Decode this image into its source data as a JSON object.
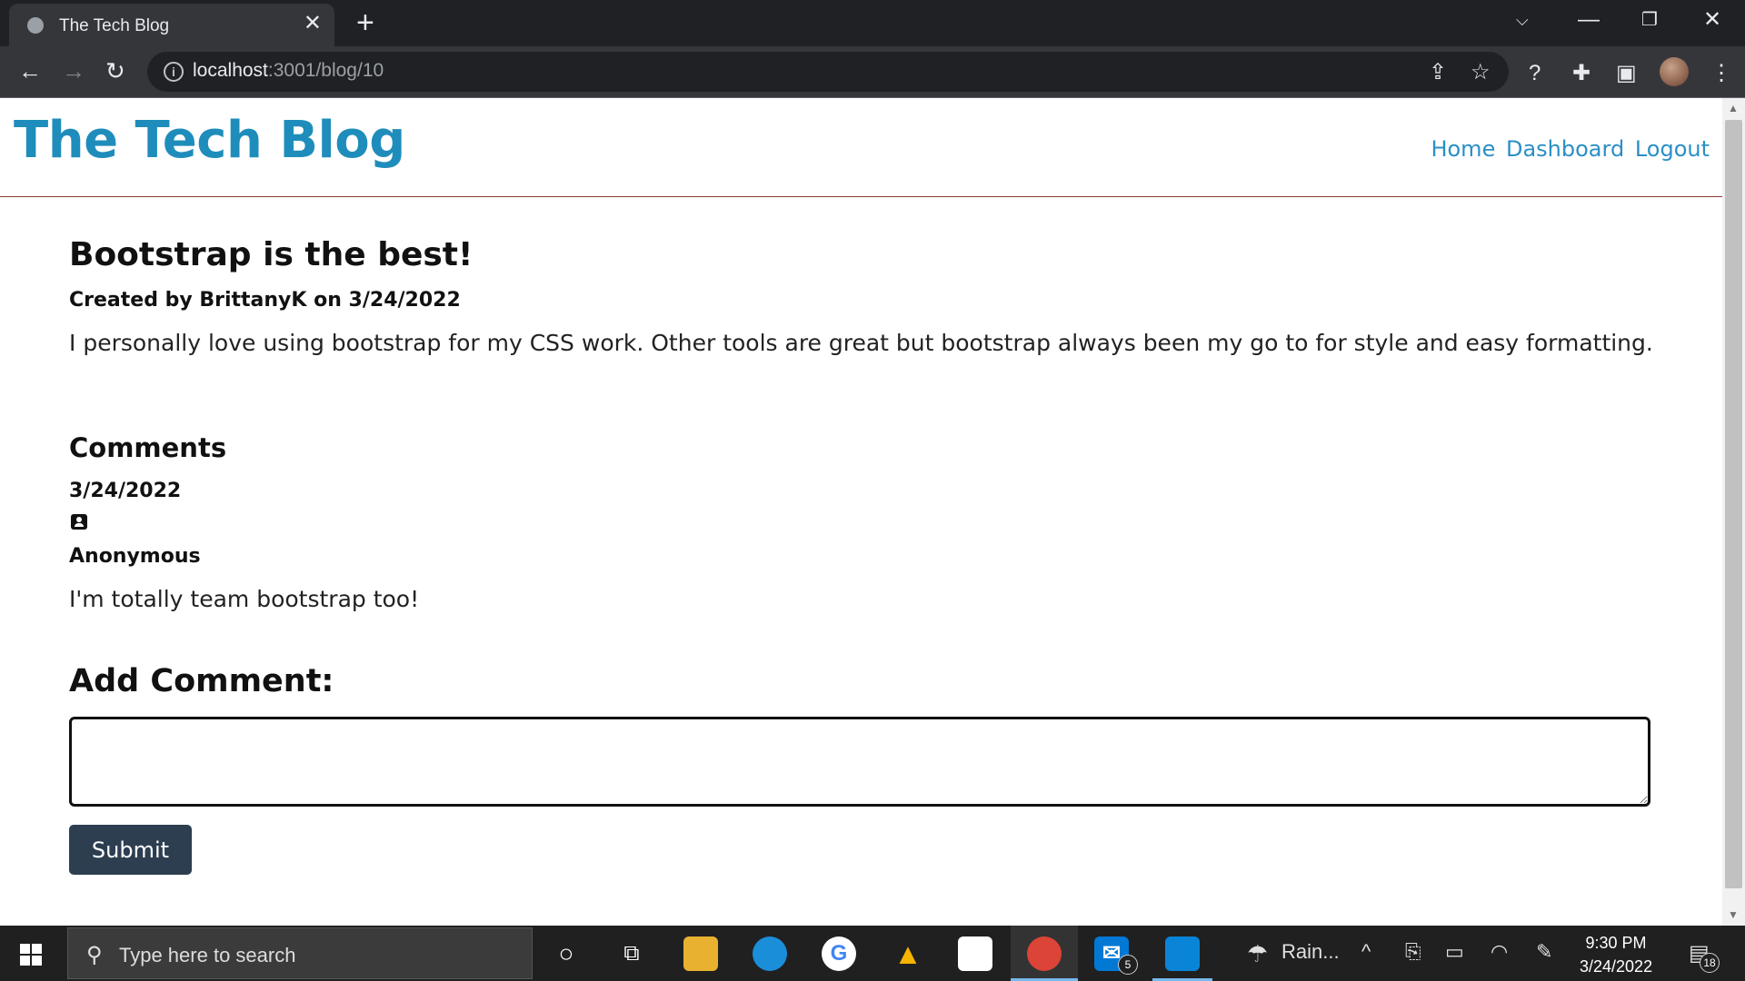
{
  "browser": {
    "tab_title": "The Tech Blog",
    "url_host": "localhost",
    "url_path": ":3001/blog/10"
  },
  "site": {
    "title": "The Tech Blog",
    "nav": [
      "Home",
      "Dashboard",
      "Logout"
    ]
  },
  "post": {
    "title": "Bootstrap is the best!",
    "meta": "Created by BrittanyK on 3/24/2022",
    "body": "I personally love using bootstrap for my CSS work. Other tools are great but bootstrap always been my go to for style and easy formatting."
  },
  "comments": {
    "heading": "Comments",
    "items": [
      {
        "date": "3/24/2022",
        "author": "Anonymous",
        "text": "I'm totally team bootstrap too!"
      }
    ]
  },
  "add_comment": {
    "heading": "Add Comment:",
    "value": "",
    "submit_label": "Submit"
  },
  "taskbar": {
    "search_placeholder": "Type here to search",
    "weather_label": "Rain...",
    "time": "9:30 PM",
    "date": "3/24/2022",
    "mail_badge": "5",
    "notification_badge": "18"
  },
  "colors": {
    "site_title": "#1f8dbb",
    "nav_link": "#2b8fc6",
    "submit_bg": "#2c3e50",
    "header_border": "#8b3a2f"
  }
}
